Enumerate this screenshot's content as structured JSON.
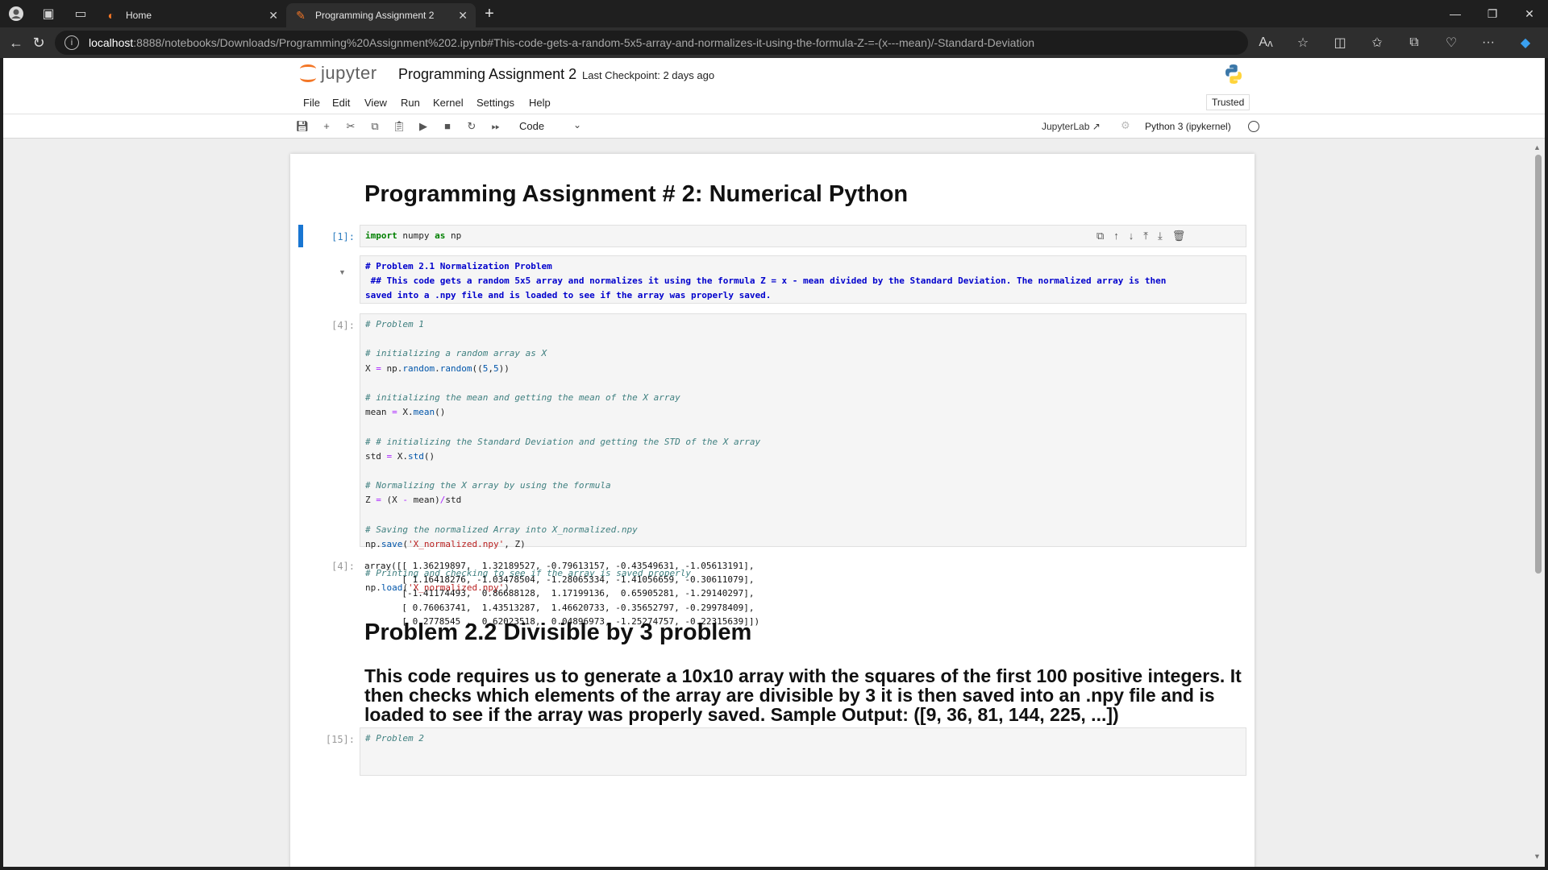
{
  "browser": {
    "tabs": [
      {
        "title": "Home"
      },
      {
        "title": "Programming Assignment 2"
      }
    ],
    "url_host": "localhost",
    "url_rest": ":8888/notebooks/Downloads/Programming%20Assignment%202.ipynb#This-code-gets-a-random-5x5-array-and-normalizes-it-using-the-formula-Z-=-(x---mean)/-Standard-Deviation"
  },
  "jupyter": {
    "logo_text": "jupyter",
    "notebook_title": "Programming Assignment 2",
    "checkpoint": "Last Checkpoint: 2 days ago",
    "menu": [
      "File",
      "Edit",
      "View",
      "Run",
      "Kernel",
      "Settings",
      "Help"
    ],
    "trusted": "Trusted",
    "cell_type": "Code",
    "jupyterlab_link": "JupyterLab",
    "kernel_name": "Python 3 (ipykernel)"
  },
  "notebook": {
    "title_heading": "Programming Assignment # 2: Numerical Python",
    "cell1": {
      "prompt": "[1]:"
    },
    "markdown1": {
      "line1": "# Problem 2.1 Normalization Problem",
      "line2": " ## This code gets a random 5x5 array and normalizes it using the formula Z = x - mean divided by the Standard Deviation. The normalized array is then",
      "line3": "saved into a .npy file and is loaded to see if the array was properly saved."
    },
    "cell4": {
      "prompt": "[4]:",
      "out_prompt": "[4]:",
      "comment1": "# Problem 1",
      "comment2": "# initializing a random array as X",
      "comment3": "# initializing the mean and getting the mean of the X array",
      "comment4": "# # initializing the Standard Deviation and getting the STD of the X array",
      "comment5": "# Normalizing the X array by using the formula",
      "comment6": "# Saving the normalized Array into X_normalized.npy",
      "comment7": "# Printing and checking to see if the array is saved properly",
      "output": [
        "array([[ 1.36219897,  1.32189527, -0.79613157, -0.43549631, -1.05613191],",
        "       [ 1.16418276, -1.03478504, -1.28065334, -1.41056659, -0.30611079],",
        "       [-1.41174493,  0.86688128,  1.17199136,  0.65905281, -1.29140297],",
        "       [ 0.76063741,  1.43513287,  1.46620733, -0.35652797, -0.29978409],",
        "       [ 0.2778545 ,  0.62023518,  0.04896973, -1.25274757, -0.22315639]])"
      ]
    },
    "heading2": "Problem 2.2 Divisible by 3 problem",
    "heading3": "This code requires us to generate a 10x10 array with the squares of the first 100 positive integers. It then checks which elements of the array are divisible by 3 it is then saved into an .npy file and is loaded to see if the array was properly saved. Sample Output: ([9, 36, 81, 144, 225, ...])",
    "cell15": {
      "prompt": "[15]:",
      "comment1": "# Problem 2"
    }
  },
  "colors": {
    "jupyter_orange": "#f37626",
    "active_cell": "#1976d2"
  }
}
